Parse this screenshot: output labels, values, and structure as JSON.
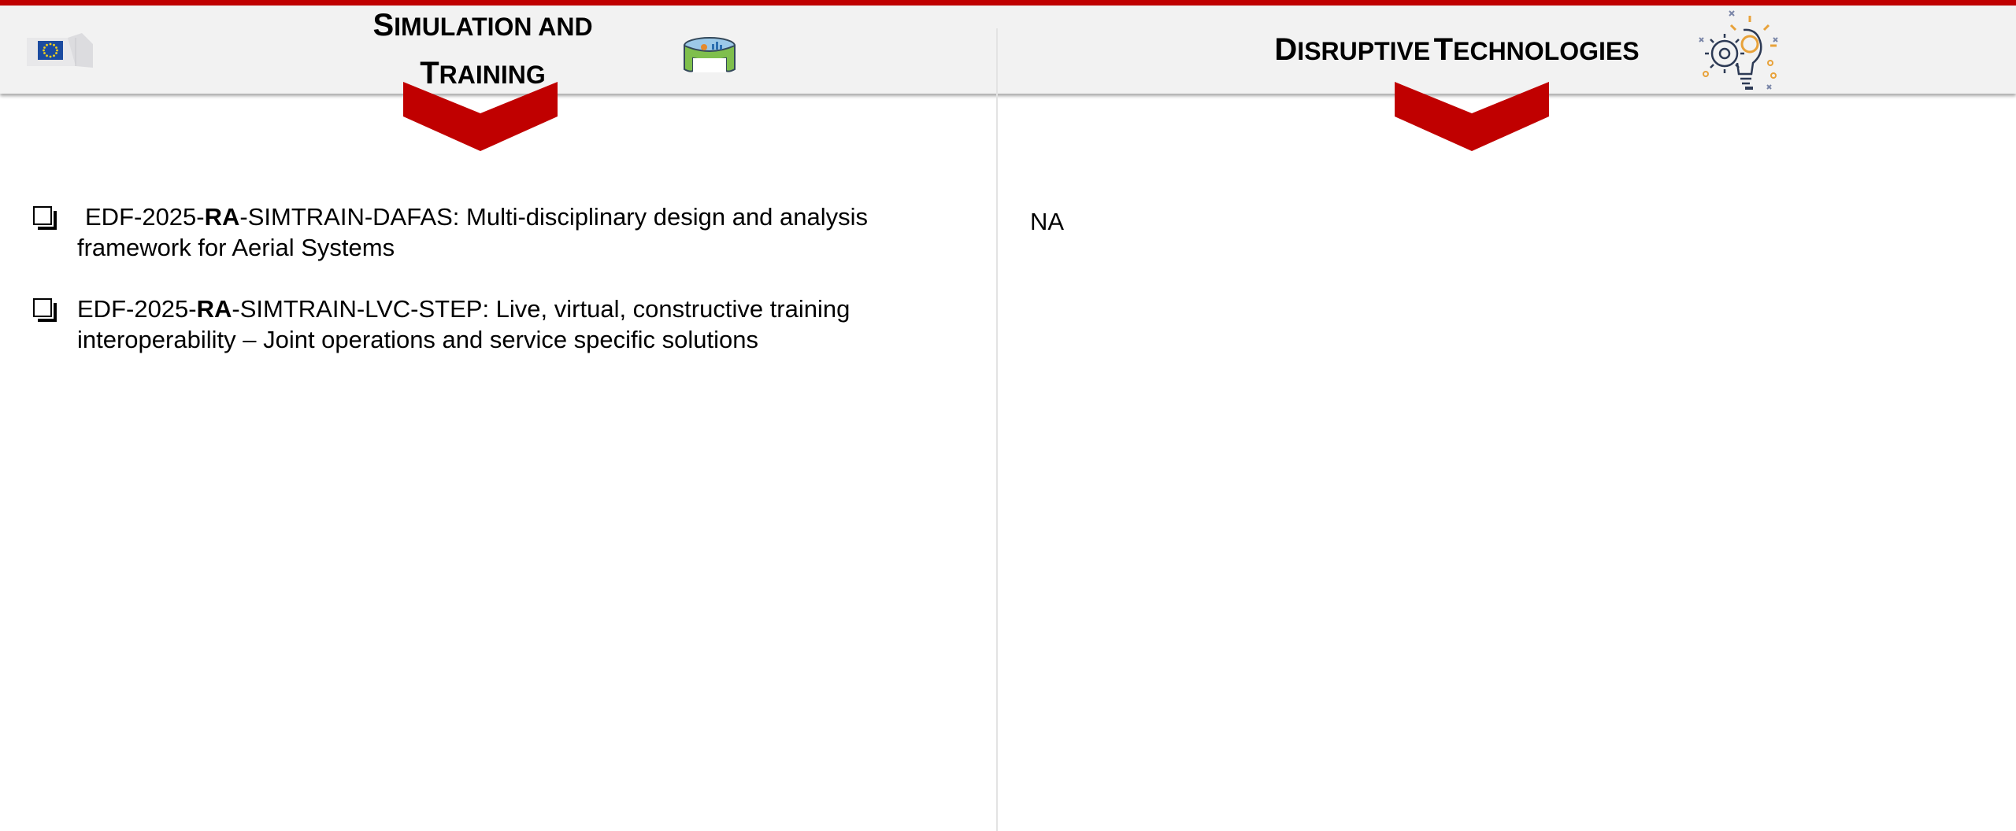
{
  "header": {
    "left_title": {
      "first_big": "S",
      "first_rest": "IMULATION AND",
      "second_big": "T",
      "second_rest": "RAINING"
    },
    "right_title": {
      "w1_big": "D",
      "w1_rest": "ISRUPTIVE",
      "w2_big": "T",
      "w2_rest": "ECHNOLOGIES"
    },
    "colors": {
      "accent": "#c00000",
      "band": "#f2f2f2"
    },
    "icons": [
      "eu-flag-logo",
      "simulation-dome-icon",
      "lightbulb-gear-icon",
      "chevron-down-icon"
    ]
  },
  "left_column": {
    "items": [
      {
        "prefix": "EDF-2025-",
        "bold": "RA",
        "rest": "-SIMTRAIN-DAFAS: Multi-disciplinary design and analysis",
        "rest2": "framework for Aerial Systems"
      },
      {
        "prefix": "EDF-2025-",
        "bold": "RA",
        "rest": "-SIMTRAIN-LVC-STEP: Live, virtual, constructive training",
        "rest2": "interoperability – Joint operations and service specific solutions"
      }
    ]
  },
  "right_column": {
    "text": "NA"
  }
}
